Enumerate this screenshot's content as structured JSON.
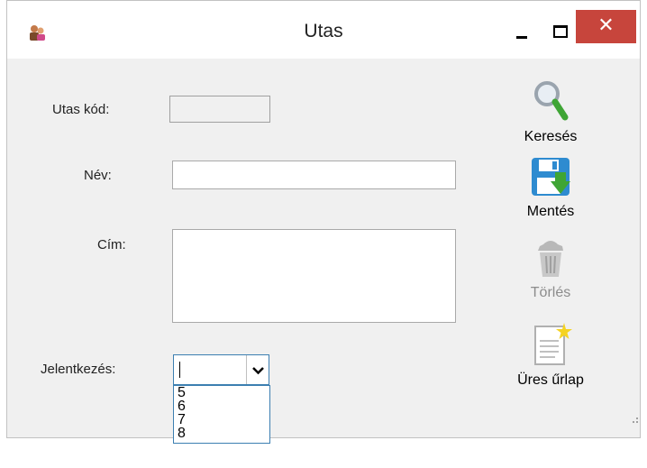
{
  "window": {
    "title": "Utas",
    "close_glyph": "✕"
  },
  "form": {
    "code_label": "Utas kód:",
    "name_label": "Név:",
    "address_label": "Cím:",
    "registration_label": "Jelentkezés:",
    "code_value": "",
    "name_value": "",
    "address_value": "",
    "registration_value": ""
  },
  "dropdown": {
    "options": [
      "5",
      "6",
      "7",
      "8"
    ]
  },
  "toolbar": {
    "search_label": "Keresés",
    "save_label": "Mentés",
    "delete_label": "Törlés",
    "new_label": "Üres űrlap",
    "delete_enabled": false
  },
  "colors": {
    "close_button": "#c7453c",
    "combo_border": "#3c7fb1",
    "disabled_text": "#8c8c8c"
  }
}
